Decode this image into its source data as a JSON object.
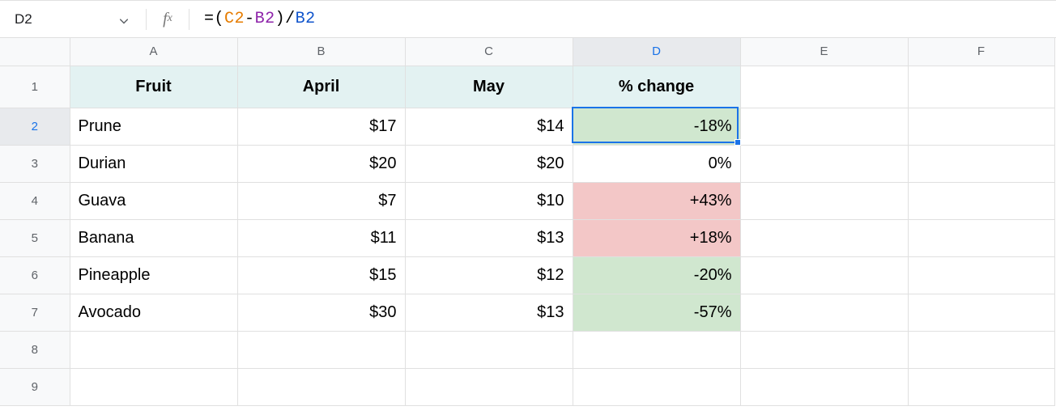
{
  "formula_bar": {
    "cell_ref": "D2",
    "eq": "=",
    "p1": "(",
    "ref_c2": "C2",
    "minus": "-",
    "ref_b2": "B2",
    "p2": ")",
    "slash": "/",
    "ref_b2b": "B2"
  },
  "columns": {
    "A": "A",
    "B": "B",
    "C": "C",
    "D": "D",
    "E": "E",
    "F": "F"
  },
  "row_labels": {
    "r1": "1",
    "r2": "2",
    "r3": "3",
    "r4": "4",
    "r5": "5",
    "r6": "6",
    "r7": "7",
    "r8": "8",
    "r9": "9"
  },
  "headers": {
    "A": "Fruit",
    "B": "April",
    "C": "May",
    "D": "% change"
  },
  "rows": [
    {
      "fruit": "Prune",
      "april": "$17",
      "may": "$14",
      "pct": "-18%",
      "pct_bg": "green"
    },
    {
      "fruit": "Durian",
      "april": "$20",
      "may": "$20",
      "pct": "0%",
      "pct_bg": ""
    },
    {
      "fruit": "Guava",
      "april": "$7",
      "may": "$10",
      "pct": "+43%",
      "pct_bg": "red"
    },
    {
      "fruit": "Banana",
      "april": "$11",
      "may": "$13",
      "pct": "+18%",
      "pct_bg": "red"
    },
    {
      "fruit": "Pineapple",
      "april": "$15",
      "may": "$12",
      "pct": "-20%",
      "pct_bg": "green"
    },
    {
      "fruit": "Avocado",
      "april": "$30",
      "may": "$13",
      "pct": "-57%",
      "pct_bg": "green"
    }
  ],
  "colors": {
    "green": "#d0e7cf",
    "red": "#f3c7c7",
    "header_bg": "#e3f2f2",
    "selection": "#1a73e8"
  }
}
